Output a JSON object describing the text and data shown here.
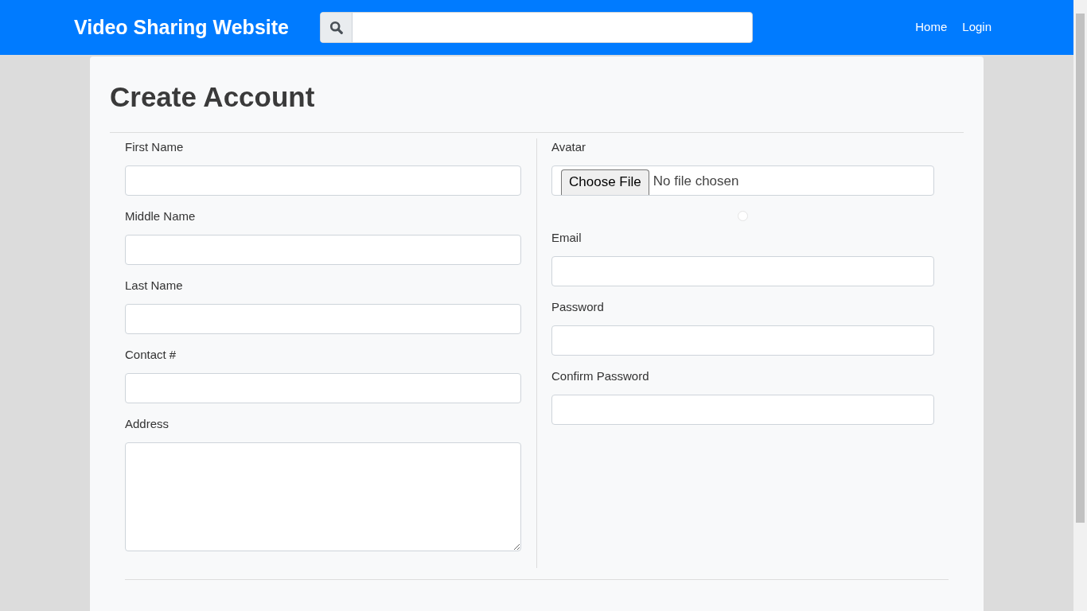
{
  "navbar": {
    "brand": "Video Sharing Website",
    "links": [
      "Home",
      "Login"
    ]
  },
  "page": {
    "title": "Create Account",
    "left_fields": [
      {
        "label": "First Name",
        "kind": "input"
      },
      {
        "label": "Middle Name",
        "kind": "input"
      },
      {
        "label": "Last Name",
        "kind": "input"
      },
      {
        "label": "Contact #",
        "kind": "input"
      },
      {
        "label": "Address",
        "kind": "textarea"
      }
    ],
    "avatar": {
      "label": "Avatar",
      "button": "Choose File",
      "status": "No file chosen"
    },
    "right_fields": [
      {
        "label": "Email"
      },
      {
        "label": "Password"
      },
      {
        "label": "Confirm Password"
      }
    ]
  }
}
